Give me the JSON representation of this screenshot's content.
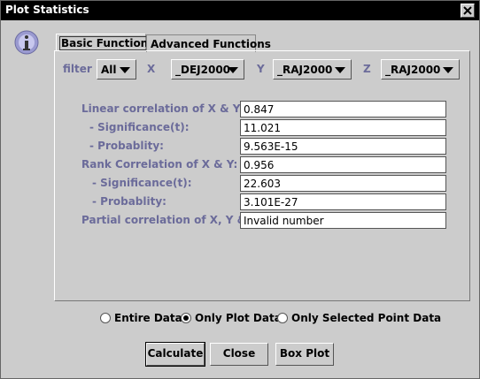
{
  "window": {
    "title": "Plot Statistics"
  },
  "tabs": [
    {
      "label": "Basic Functions",
      "active": true
    },
    {
      "label": "Advanced Functions",
      "active": false
    }
  ],
  "filter": {
    "label": "filter",
    "value": "All",
    "x_label": "X",
    "x_value": "_DEJ2000",
    "y_label": "Y",
    "y_value": "_RAJ2000",
    "z_label": "Z",
    "z_value": "_RAJ2000"
  },
  "stats": [
    {
      "label": "Linear correlation of X & Y:",
      "value": "0.847"
    },
    {
      "label": "- Significance(t):",
      "value": "11.021"
    },
    {
      "label": "- Probablity:",
      "value": "9.563E-15"
    },
    {
      "label": "Rank Correlation of X & Y:",
      "value": "0.956"
    },
    {
      "label": "- Significance(t):",
      "value": "22.603"
    },
    {
      "label": "- Probablity:",
      "value": "3.101E-27"
    },
    {
      "label": "Partial correlation of X, Y & Z:",
      "value": "Invalid number"
    }
  ],
  "data_options": [
    {
      "label": "Entire Data",
      "selected": false
    },
    {
      "label": "Only Plot Data",
      "selected": true
    },
    {
      "label": "Only Selected Point Data",
      "selected": false
    }
  ],
  "buttons": {
    "calculate": "Calculate",
    "close": "Close",
    "box_plot": "Box Plot"
  }
}
